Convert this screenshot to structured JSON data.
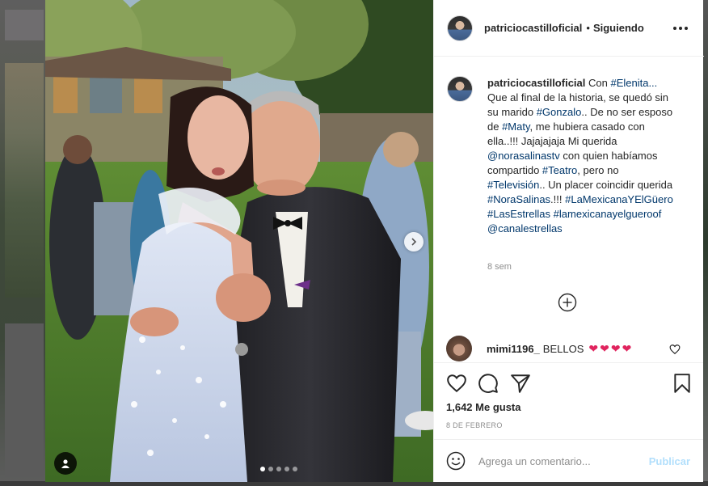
{
  "post": {
    "username": "patriciocastilloficial",
    "follow_status": "Siguiendo",
    "header_separator": "•",
    "caption": {
      "username": "patriciocastilloficial",
      "segments": [
        {
          "t": "Con ",
          "link": false
        },
        {
          "t": "#Elenita...",
          "link": true
        },
        {
          "t": " Que al final de la historia, se quedó sin su marido ",
          "link": false
        },
        {
          "t": "#Gonzalo",
          "link": true
        },
        {
          "t": ".. De no ser esposo de ",
          "link": false
        },
        {
          "t": "#Maty",
          "link": true
        },
        {
          "t": ", me hubiera casado con ella..!!! Jajajajaja Mi querida ",
          "link": false
        },
        {
          "t": "@norasalinastv",
          "link": true
        },
        {
          "t": " con quien habíamos compartido ",
          "link": false
        },
        {
          "t": "#Teatro",
          "link": true
        },
        {
          "t": ", pero no ",
          "link": false
        },
        {
          "t": "#Televisión",
          "link": true
        },
        {
          "t": ".. Un placer coincidir querida ",
          "link": false
        },
        {
          "t": "#NoraSalinas",
          "link": true
        },
        {
          "t": ".!!! ",
          "link": false
        },
        {
          "t": "#LaMexicanaYElGüero",
          "link": true
        },
        {
          "t": " ",
          "link": false
        },
        {
          "t": "#LasEstrellas",
          "link": true
        },
        {
          "t": " ",
          "link": false
        },
        {
          "t": "#lamexicanayelgueroof",
          "link": true
        },
        {
          "t": " ",
          "link": false
        },
        {
          "t": "@canalestrellas",
          "link": true
        }
      ],
      "time_ago": "8 sem"
    },
    "comments": [
      {
        "username": "mimi1196_",
        "text": "BELLOS",
        "hearts": 4
      }
    ],
    "likes": "1,642 Me gusta",
    "date": "8 DE FEBRERO",
    "comment_placeholder": "Agrega un comentario...",
    "publish_label": "Publicar",
    "carousel": {
      "total": 5,
      "active": 0
    }
  },
  "icons": {
    "more": "more-options-icon",
    "load_more": "plus-circle-icon",
    "comment_like": "heart-outline-icon",
    "like": "heart-icon",
    "comment": "comment-bubble-icon",
    "share": "paper-plane-icon",
    "save": "bookmark-icon",
    "emoji": "smiley-icon",
    "next": "chevron-right-icon",
    "tag": "user-tag-icon"
  },
  "colors": {
    "link": "#00376b",
    "muted": "#8e8e8e",
    "publish_disabled": "#b2dffc",
    "heart": "#e0245e"
  }
}
